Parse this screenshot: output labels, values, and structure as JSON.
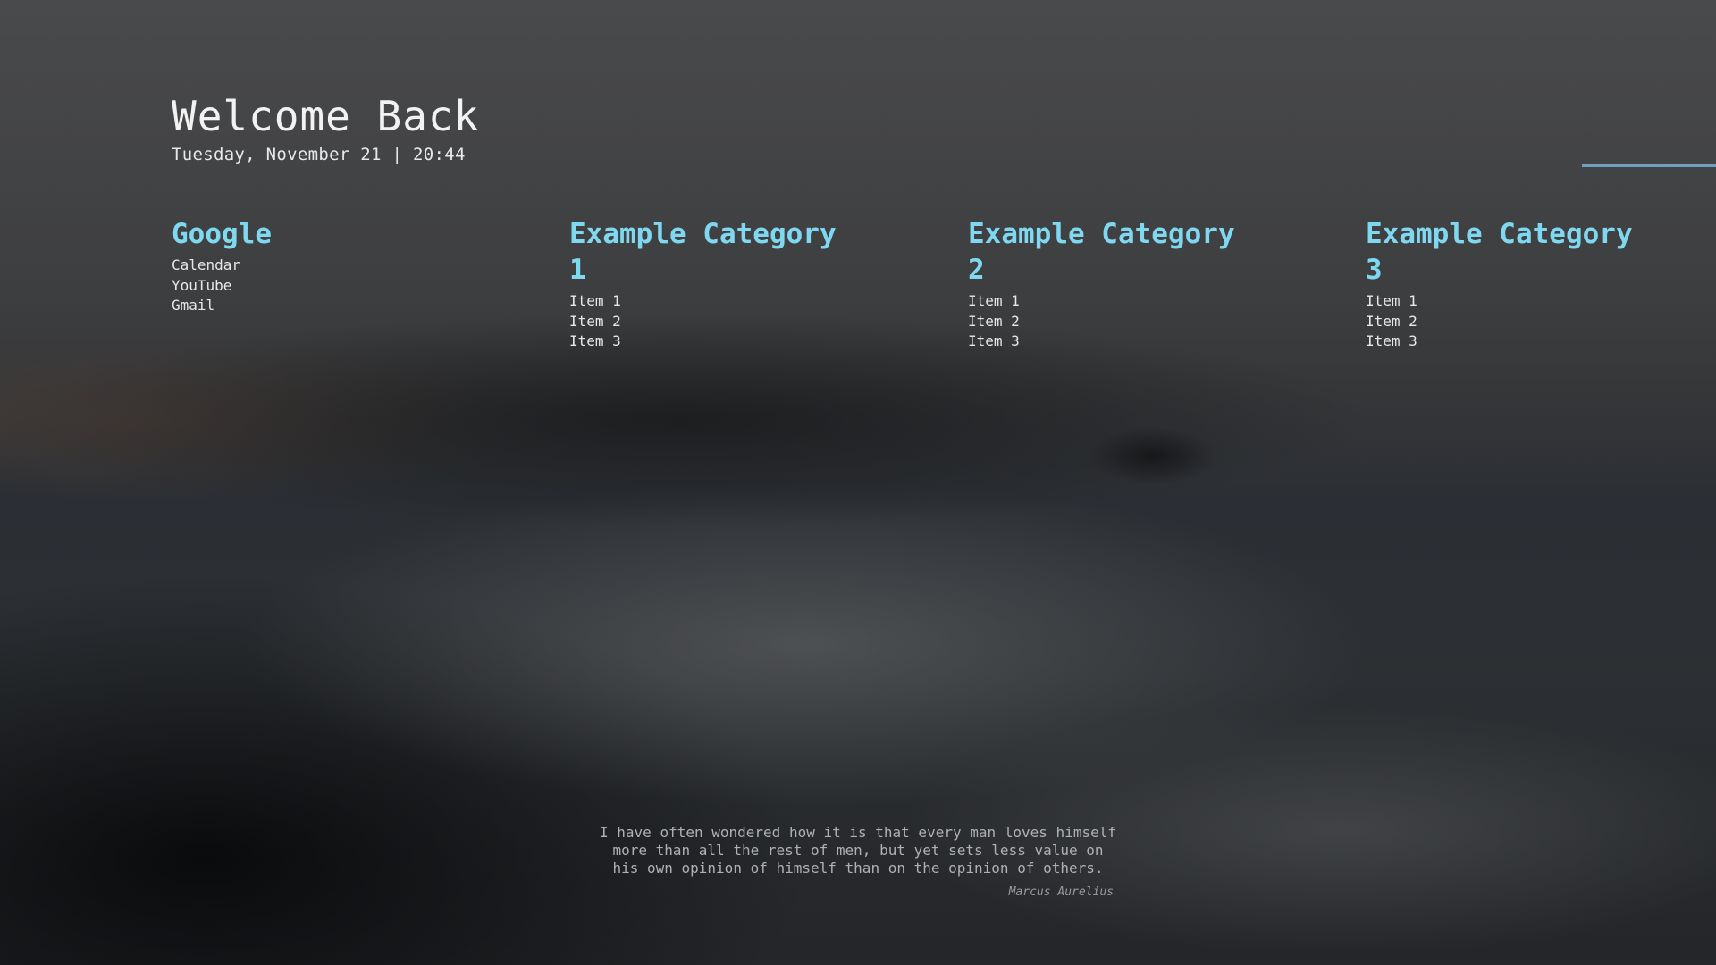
{
  "header": {
    "title": "Welcome Back",
    "datetime": "Tuesday, November 21 | 20:44"
  },
  "progress": {
    "color": "#6e9fbf"
  },
  "categories": [
    {
      "title": "Google",
      "items": [
        {
          "label": "Calendar"
        },
        {
          "label": "YouTube"
        },
        {
          "label": "Gmail"
        }
      ]
    },
    {
      "title": "Example Category 1",
      "items": [
        {
          "label": "Item 1"
        },
        {
          "label": "Item 2"
        },
        {
          "label": "Item 3"
        }
      ]
    },
    {
      "title": "Example Category 2",
      "items": [
        {
          "label": "Item 1"
        },
        {
          "label": "Item 2"
        },
        {
          "label": "Item 3"
        }
      ]
    },
    {
      "title": "Example Category 3",
      "items": [
        {
          "label": "Item 1"
        },
        {
          "label": "Item 2"
        },
        {
          "label": "Item 3"
        }
      ]
    }
  ],
  "quote": {
    "text": "I have often wondered how it is that every man loves himself more than all the rest of men, but yet sets less value on his own opinion of himself than on the opinion of others.",
    "author": "Marcus Aurelius"
  },
  "colors": {
    "accent": "#7fd8f0",
    "text": "#e8e8e8",
    "quote": "#b0b0b0"
  }
}
